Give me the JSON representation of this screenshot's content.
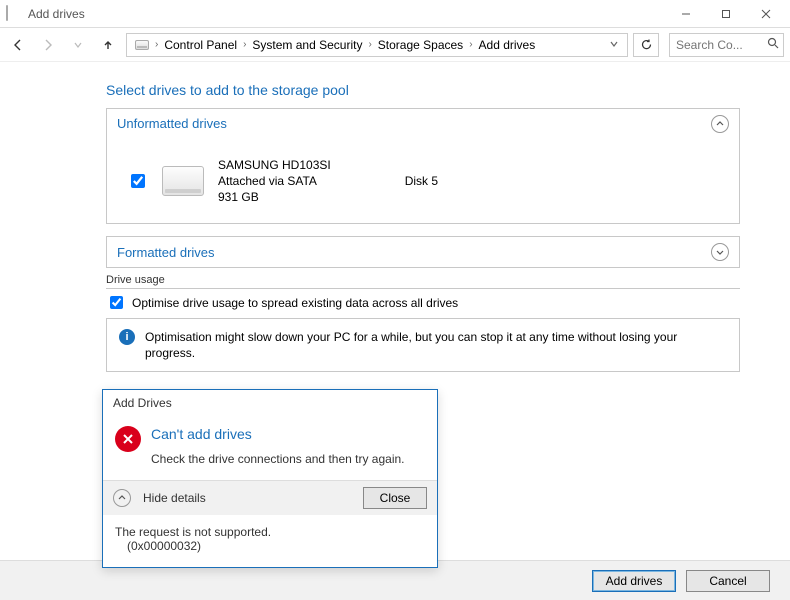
{
  "window": {
    "title": "Add drives"
  },
  "breadcrumbs": {
    "items": [
      "Control Panel",
      "System and Security",
      "Storage Spaces",
      "Add drives"
    ]
  },
  "search": {
    "placeholder": "Search Co..."
  },
  "page": {
    "heading": "Select drives to add to the storage pool",
    "unformatted_header": "Unformatted drives",
    "formatted_header": "Formatted drives",
    "drive_usage_label": "Drive usage",
    "optimise_label": "Optimise drive usage to spread existing data across all drives",
    "optimise_checked": true,
    "info_text": "Optimisation might slow down your PC for a while, but you can stop it at any time without losing your progress."
  },
  "drives": [
    {
      "checked": true,
      "name": "SAMSUNG HD103SI",
      "connection": "Attached via SATA",
      "size": "931 GB",
      "disk": "Disk 5"
    }
  ],
  "dialog": {
    "title": "Add Drives",
    "heading": "Can't add drives",
    "message": "Check the drive connections and then try again.",
    "details_toggle": "Hide details",
    "close_label": "Close",
    "details_line1": "The request is not supported.",
    "details_line2": "(0x00000032)"
  },
  "footer": {
    "primary": "Add drives",
    "secondary": "Cancel"
  }
}
